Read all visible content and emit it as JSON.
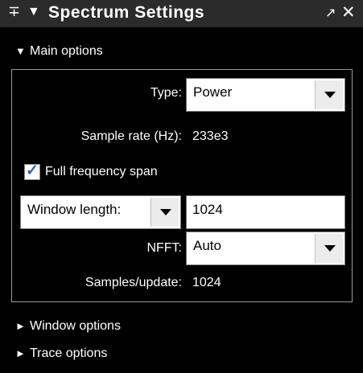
{
  "title_bar": {
    "title": "Spectrum Settings",
    "pin_icon": "pin-icon",
    "menu_icon": "triangle-down-icon",
    "undock_icon": "undock-arrow-icon",
    "close_icon": "close-icon",
    "pin_glyph": "∓",
    "menu_glyph": "▼",
    "undock_glyph": "↗",
    "close_glyph": "✕"
  },
  "sections": {
    "main": {
      "label": "Main options",
      "expanded": true,
      "glyph": "▼"
    },
    "window": {
      "label": "Window options",
      "expanded": false,
      "glyph": "►"
    },
    "trace": {
      "label": "Trace options",
      "expanded": false,
      "glyph": "►"
    }
  },
  "main_options": {
    "type_label": "Type:",
    "type_value": "Power",
    "sample_rate_label": "Sample rate (Hz):",
    "sample_rate_value": "233e3",
    "full_span_label": "Full frequency span",
    "full_span_checked": true,
    "check_glyph": "✓",
    "window_length_select": "Window length:",
    "window_length_value": "1024",
    "nfft_label": "NFFT:",
    "nfft_value": "Auto",
    "samples_update_label": "Samples/update:",
    "samples_update_value": "1024"
  },
  "colors": {
    "background": "#000000",
    "title_bar": "#2b2b2b",
    "panel_border": "#9a9a9a",
    "checkbox_mark": "#2b5fb8"
  }
}
